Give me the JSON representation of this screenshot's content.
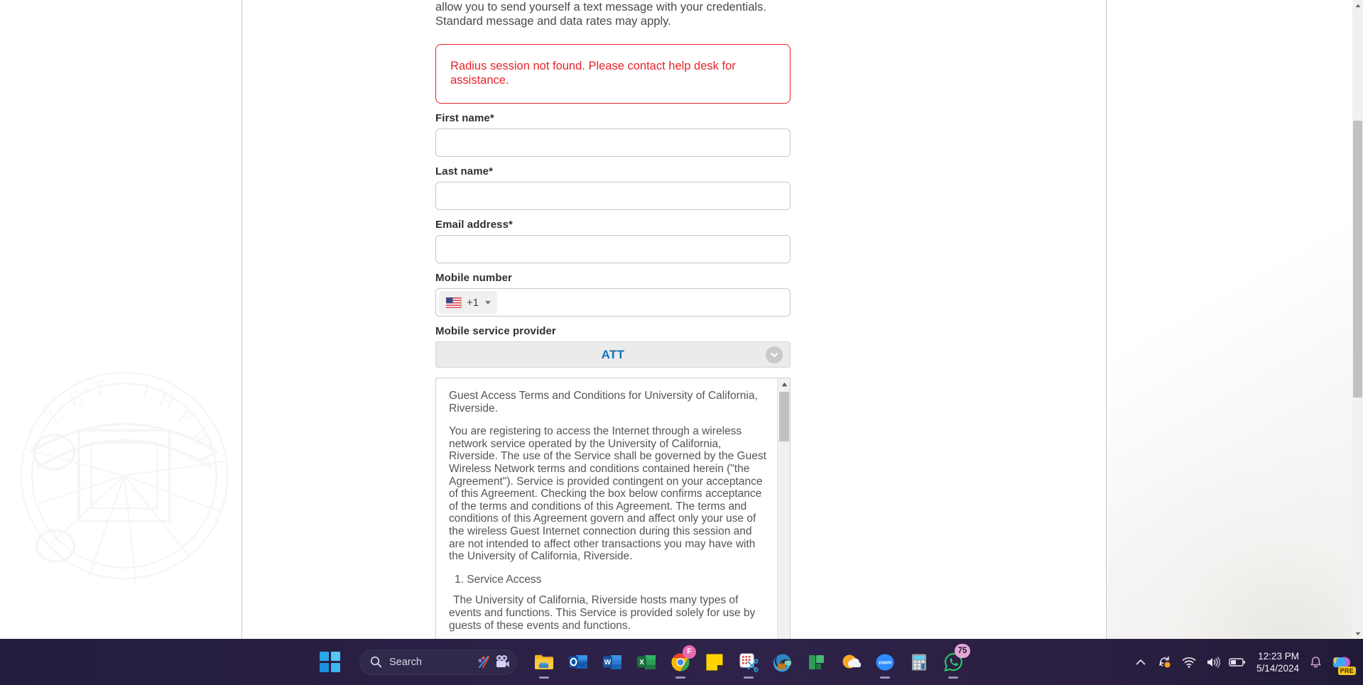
{
  "page": {
    "intro_line1": "allow you to send yourself a text message with your credentials.",
    "intro_line2": "Standard message and data rates may apply.",
    "alert_message": "Radius session not found. Please contact help desk for assistance.",
    "alert_color": "#e8232a"
  },
  "form": {
    "first_name": {
      "label": "First name*",
      "value": "",
      "placeholder": ""
    },
    "last_name": {
      "label": "Last name*",
      "value": "",
      "placeholder": ""
    },
    "email": {
      "label": "Email address*",
      "value": "",
      "placeholder": ""
    },
    "mobile": {
      "label": "Mobile number",
      "value": "",
      "placeholder": "",
      "country_flag": "us-flag-icon",
      "dial_code": "+1"
    },
    "provider": {
      "label": "Mobile service provider",
      "selected": "ATT",
      "accent_color": "#1272b8"
    }
  },
  "terms": {
    "title": "Guest Access Terms and Conditions for University of California, Riverside.",
    "paragraph_1": "You are registering to access the Internet through a wireless network service operated by the University of California, Riverside. The use of the Service shall be governed by the Guest Wireless Network terms and conditions contained herein (\"the Agreement\"). Service is provided contingent on your acceptance of this Agreement. Checking the box below confirms acceptance of the terms and conditions of this Agreement. The terms and conditions of this Agreement govern and affect only your use of the wireless Guest Internet connection during this session and are not intended to affect other transactions you may have with the University of California, Riverside.",
    "section_1_heading": "1. Service Access",
    "section_1_body": "The University of California, Riverside hosts many types of events and functions. This Service is provided solely for use by guests of these events and functions."
  },
  "taskbar": {
    "start_label": "start-button",
    "search_placeholder": "Search",
    "apps": [
      {
        "name": "file-explorer",
        "label": "File Explorer"
      },
      {
        "name": "outlook",
        "label": "Outlook"
      },
      {
        "name": "word",
        "label": "Word"
      },
      {
        "name": "excel",
        "label": "Excel"
      },
      {
        "name": "chrome",
        "label": "Google Chrome",
        "badge": "F"
      },
      {
        "name": "sticky-notes",
        "label": "Sticky Notes"
      },
      {
        "name": "snipping-tool",
        "label": "Snipping Tool"
      },
      {
        "name": "edge",
        "label": "Microsoft Edge"
      },
      {
        "name": "planner",
        "label": "Planner"
      },
      {
        "name": "weather",
        "label": "Weather"
      },
      {
        "name": "zoom",
        "label": "zoom"
      },
      {
        "name": "calculator",
        "label": "Calculator"
      },
      {
        "name": "whatsapp",
        "label": "WhatsApp",
        "badge": "75"
      }
    ],
    "zoom_label": "zoom",
    "chrome_badge": "F",
    "whatsapp_badge": "75",
    "tray": {
      "time": "12:23 PM",
      "date": "5/14/2024",
      "copilot_badge": "PRE"
    }
  }
}
